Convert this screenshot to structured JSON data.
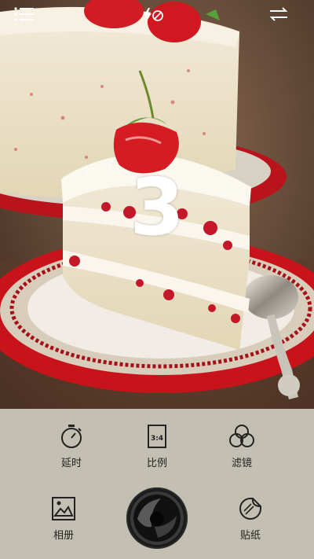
{
  "topbar": {
    "menu_icon": "hamburger-menu-icon",
    "flash_icon": "flash-off-icon",
    "switch_icon": "switch-camera-icon"
  },
  "viewfinder": {
    "countdown": "3"
  },
  "tools": {
    "timer": {
      "label": "延时",
      "icon": "stopwatch-icon"
    },
    "ratio": {
      "label": "比例",
      "icon": "aspect-ratio-icon",
      "icon_text": "3:4"
    },
    "filter": {
      "label": "滤镜",
      "icon": "filter-circles-icon"
    },
    "album": {
      "label": "相册",
      "icon": "image-icon"
    },
    "sticker": {
      "label": "贴纸",
      "icon": "sticker-icon"
    }
  },
  "colors": {
    "panel_bg": "#c3bfb2",
    "plate_red": "#c9131b",
    "shutter": "#1b1b1b"
  }
}
